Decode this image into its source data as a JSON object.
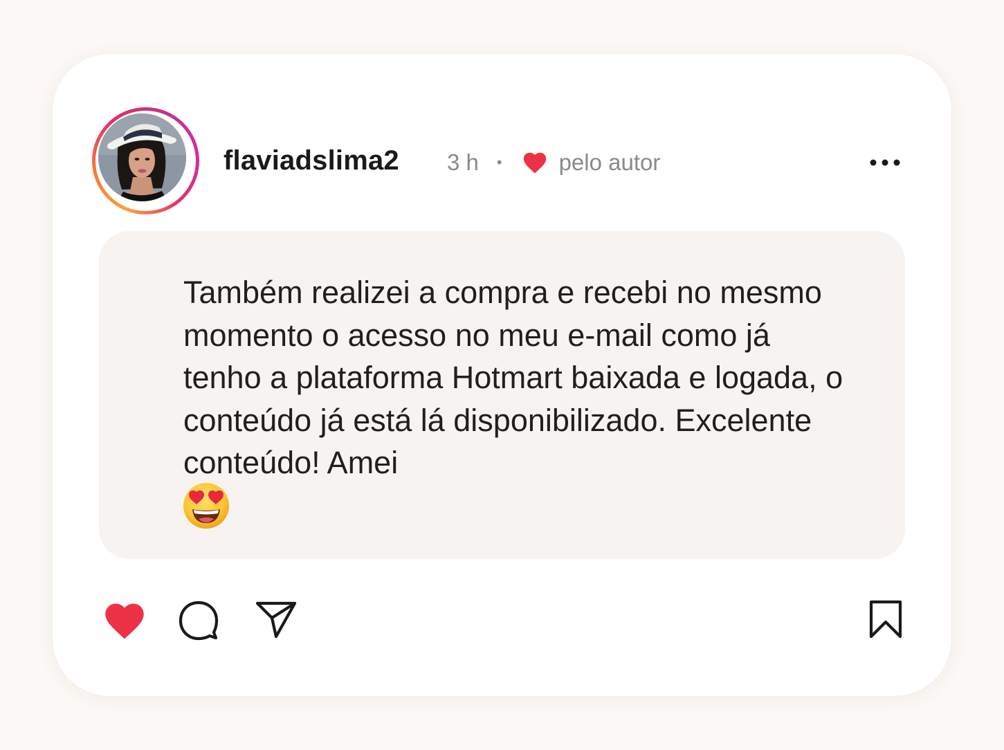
{
  "post": {
    "username": "flaviadslima2",
    "time": "3 h",
    "separator": "•",
    "liked_by_author": "pelo autor",
    "comment_text": "Também realizei a compra e recebi no mesmo momento o acesso no meu e-mail como já tenho a plataforma Hotmart baixada e logada, o conteúdo já está lá disponibilizado. Excelente conteúdo! Amei",
    "emoji": "smiling-face-with-heart-eyes"
  },
  "actions": {
    "like": {
      "icon": "heart-icon",
      "state": "liked"
    },
    "comment": {
      "icon": "comment-bubble-icon"
    },
    "share": {
      "icon": "send-paper-plane-icon"
    },
    "save": {
      "icon": "bookmark-icon"
    },
    "more": {
      "icon": "more-dots-icon"
    }
  },
  "colors": {
    "background": "#fbf8f5",
    "card": "#ffffff",
    "bubble": "#f6f3f1",
    "heart": "#ed3146",
    "text": "#1f1f1f",
    "meta": "#8a8a8a",
    "story_ring": [
      "#f9a23a",
      "#e1306c",
      "#c13584"
    ]
  }
}
